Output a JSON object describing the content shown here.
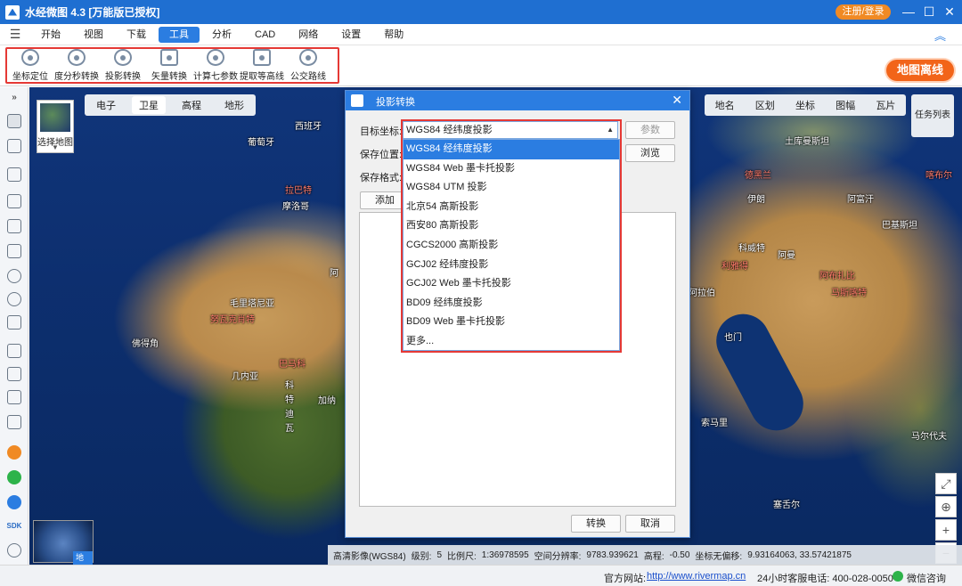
{
  "titlebar": {
    "title": "水经微图 4.3 [万能版已授权]",
    "login": "注册/登录",
    "min": "—",
    "max": "☐",
    "close": "✕"
  },
  "menu": {
    "items": [
      "开始",
      "视图",
      "下载",
      "工具",
      "分析",
      "CAD",
      "网络",
      "设置",
      "帮助"
    ],
    "active": "工具"
  },
  "toolbar": {
    "tools": [
      "坐标定位",
      "度分秒转换",
      "投影转换",
      "矢量转换",
      "计算七参数",
      "提取等高线",
      "公交路线"
    ],
    "offline": "地图离线"
  },
  "map": {
    "basemap": "选择地图",
    "layer_tabs": [
      "电子",
      "卫星",
      "高程",
      "地形"
    ],
    "layer_active": "卫星",
    "right_tabs": [
      "地名",
      "区划",
      "坐标",
      "图幅",
      "瓦片"
    ],
    "task_list": "任务列表",
    "globe": "地球",
    "labels": [
      {
        "text": "西班牙",
        "red": false
      },
      {
        "text": "葡萄牙",
        "red": false
      },
      {
        "text": "拉巴特",
        "red": true
      },
      {
        "text": "摩洛哥",
        "red": false
      },
      {
        "text": "毛里塔尼亚",
        "red": false
      },
      {
        "text": "努瓦克肖特",
        "red": true
      },
      {
        "text": "佛得角",
        "red": false
      },
      {
        "text": "几内亚",
        "red": false
      },
      {
        "text": "巴马科",
        "red": true
      },
      {
        "text": "科",
        "red": false
      },
      {
        "text": "特",
        "red": false
      },
      {
        "text": "迪",
        "red": false
      },
      {
        "text": "瓦",
        "red": false
      },
      {
        "text": "加纳",
        "red": false
      },
      {
        "text": "阿",
        "red": false
      },
      {
        "text": "土库曼斯坦",
        "red": false
      },
      {
        "text": "德黑兰",
        "red": true
      },
      {
        "text": "伊朗",
        "red": false
      },
      {
        "text": "阿富汗",
        "red": false
      },
      {
        "text": "巴基斯坦",
        "red": false
      },
      {
        "text": "科威特",
        "red": false
      },
      {
        "text": "阿曼",
        "red": false
      },
      {
        "text": "利雅得",
        "red": true
      },
      {
        "text": "阿布扎比",
        "red": false
      },
      {
        "text": "马斯喀特",
        "red": true
      },
      {
        "text": "阿拉伯",
        "red": false
      },
      {
        "text": "也门",
        "red": false
      },
      {
        "text": "索马里",
        "red": false
      },
      {
        "text": "马尔代夫",
        "red": false
      },
      {
        "text": "塞舌尔",
        "red": false
      },
      {
        "text": "喀布尔",
        "red": true
      }
    ],
    "status": {
      "source": "高清影像(WGS84)",
      "level_label": "级别:",
      "level": "5",
      "scale_label": "比例尺:",
      "scale": "1:36978595",
      "res_label": "空间分辨率:",
      "res": "9783.939621",
      "elev_label": "高程:",
      "elev": "-0.50",
      "coord_label": "坐标无偏移:",
      "coord": "9.93164063, 33.57421875"
    }
  },
  "dialog": {
    "title": "投影转换",
    "target_label": "目标坐标:",
    "target_value": "WGS84 经纬度投影",
    "params_btn": "参数",
    "save_label": "保存位置:",
    "browse_btn": "浏览",
    "format_label": "保存格式:",
    "add_btn": "添加",
    "convert_btn": "转换",
    "cancel_btn": "取消",
    "options": [
      "WGS84 经纬度投影",
      "WGS84 Web 墨卡托投影",
      "WGS84 UTM 投影",
      "北京54 高斯投影",
      "西安80 高斯投影",
      "CGCS2000 高斯投影",
      "GCJ02 经纬度投影",
      "GCJ02 Web 墨卡托投影",
      "BD09 经纬度投影",
      "BD09 Web 墨卡托投影",
      "更多..."
    ]
  },
  "bottombar": {
    "site_label": "官方网站:",
    "site": "http://www.rivermap.cn",
    "hotline": "24小时客服电话: 400-028-0050",
    "wechat": "微信咨询"
  }
}
